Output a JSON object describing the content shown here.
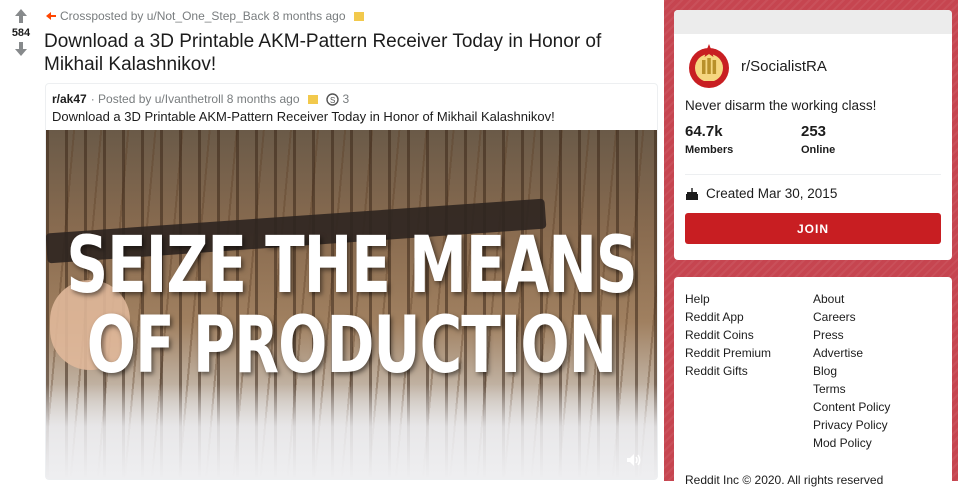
{
  "post": {
    "score": "584",
    "crosspost_line": "Crossposted by u/Not_One_Step_Back 8 months ago",
    "title": "Download a 3D Printable AKM-Pattern Receiver Today in Honor of Mikhail Kalashnikov!"
  },
  "embedded": {
    "subreddit": "r/ak47",
    "posted_by": "· Posted by u/Ivanthetroll 8 months ago",
    "award_count": "3",
    "title": "Download a 3D Printable AKM-Pattern Receiver Today in Honor of Mikhail Kalashnikov!",
    "overlay_line1": "SEIZE THE MEANS",
    "overlay_line2": "OF PRODUCTION"
  },
  "community": {
    "name": "r/SocialistRA",
    "description": "Never disarm the working class!",
    "members_value": "64.7k",
    "members_label": "Members",
    "online_value": "253",
    "online_label": "Online",
    "created": "Created Mar 30, 2015",
    "join_label": "JOIN"
  },
  "footer": {
    "left_links": [
      "Help",
      "Reddit App",
      "Reddit Coins",
      "Reddit Premium",
      "Reddit Gifts"
    ],
    "right_links": [
      "About",
      "Careers",
      "Press",
      "Advertise",
      "Blog",
      "Terms",
      "Content Policy",
      "Privacy Policy",
      "Mod Policy"
    ],
    "copyright": "Reddit Inc © 2020. All rights reserved"
  },
  "colors": {
    "sidebar_bg": "#c64550",
    "join_button": "#c81e22",
    "award": "#f2c94c",
    "crosspost_icon": "#ff4500"
  },
  "icons": {
    "upvote": "arrow-up-icon",
    "downvote": "arrow-down-icon",
    "crosspost": "crosspost-icon",
    "award": "award-icon",
    "coin": "coin-icon",
    "cake": "cake-icon",
    "volume": "volume-icon",
    "emblem": "subreddit-emblem-icon"
  }
}
